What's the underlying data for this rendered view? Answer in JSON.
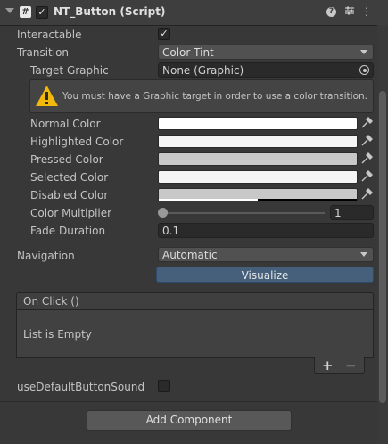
{
  "component": {
    "title": "NT_Button (Script)",
    "enabled": true,
    "script_icon": "#",
    "help_icon": "?",
    "presets_icon": "sliders-icon",
    "menu_icon": "⋮"
  },
  "fields": {
    "interactable_label": "Interactable",
    "interactable": true,
    "transition_label": "Transition",
    "transition_value": "Color Tint",
    "target_graphic_label": "Target Graphic",
    "target_graphic_value": "None (Graphic)",
    "warning": "You must have a Graphic target in order to use a color transition.",
    "normal_color_label": "Normal Color",
    "normal_color": "#ffffff",
    "highlighted_color_label": "Highlighted Color",
    "highlighted_color": "#f5f5f5",
    "pressed_color_label": "Pressed Color",
    "pressed_color": "#c8c8c8",
    "selected_color_label": "Selected Color",
    "selected_color": "#f5f5f5",
    "disabled_color_label": "Disabled Color",
    "disabled_color": "#c8c8c8",
    "disabled_alpha": 0.5,
    "color_multiplier_label": "Color Multiplier",
    "color_multiplier": "1",
    "fade_duration_label": "Fade Duration",
    "fade_duration": "0.1",
    "navigation_label": "Navigation",
    "navigation_value": "Automatic",
    "visualize_label": "Visualize",
    "use_default_sound_label": "useDefaultButtonSound",
    "use_default_sound": false
  },
  "on_click": {
    "header": "On Click ()",
    "empty_text": "List is Empty",
    "add_label": "+",
    "remove_label": "−"
  },
  "footer": {
    "add_component_label": "Add Component"
  }
}
